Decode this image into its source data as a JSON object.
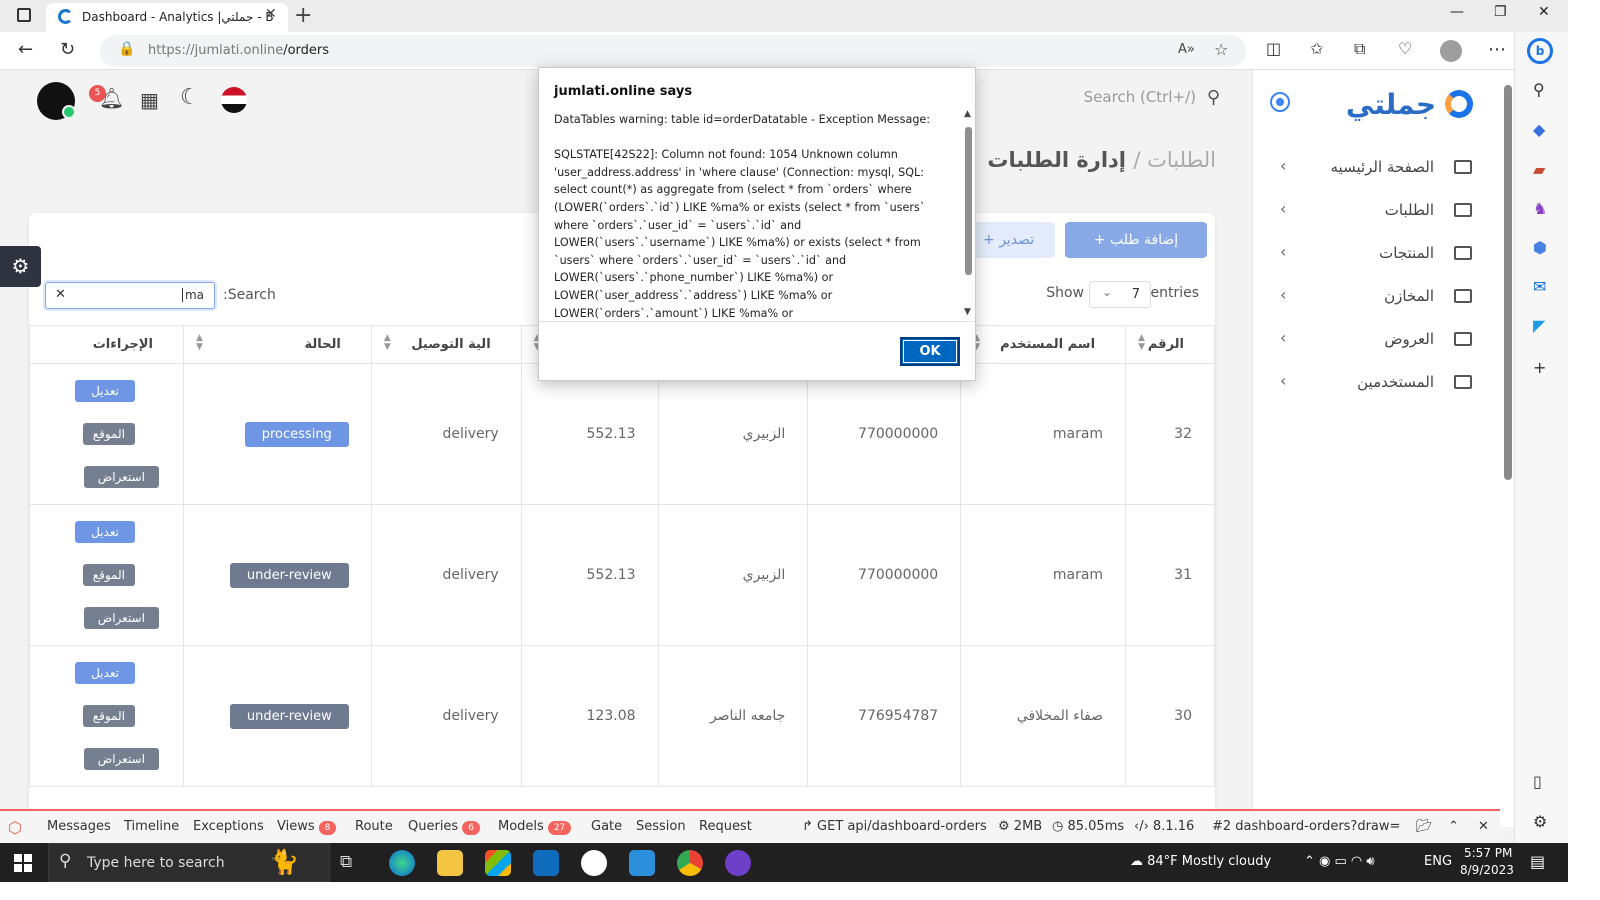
{
  "browser": {
    "tab_title": "Dashboard - Analytics |جملتي - B",
    "url_domain": "https://jumlati.online",
    "url_path": "/orders"
  },
  "sidebar": {
    "logo": "جملتي",
    "items": [
      {
        "label": "الصفحة الرئيسيه"
      },
      {
        "label": "الطلبات"
      },
      {
        "label": "المنتجات"
      },
      {
        "label": "المخازن"
      },
      {
        "label": "العروض"
      },
      {
        "label": "المستخدمين"
      }
    ]
  },
  "header": {
    "search_placeholder": "Search (Ctrl+/)",
    "notif_count": "5"
  },
  "page": {
    "breadcrumb": "الطلبات /",
    "title": "إدارة الطلبات"
  },
  "toolbar": {
    "add_label": "+ إضافة طلب",
    "export_label": "+ تصدير",
    "show_label": "Show",
    "entries_value": "7",
    "entries_label": "entries",
    "search_label": ":Search",
    "search_value": "ma"
  },
  "table": {
    "headers": [
      "الرقم",
      "اسم المستخدم",
      "",
      "",
      "",
      "الية التوصيل",
      "الحالة",
      "الإجراءات"
    ],
    "rows": [
      {
        "id": "32",
        "user": "maram",
        "phone": "770000000",
        "address": "الزبيري",
        "amount": "552.13",
        "delivery": "delivery",
        "status": "processing"
      },
      {
        "id": "31",
        "user": "maram",
        "phone": "770000000",
        "address": "الزبيري",
        "amount": "552.13",
        "delivery": "delivery",
        "status": "under-review"
      },
      {
        "id": "30",
        "user": "صفاء المخلافي",
        "phone": "776954787",
        "address": "جامعه الناصر",
        "amount": "123.08",
        "delivery": "delivery",
        "status": "under-review"
      }
    ],
    "actions": {
      "edit": "تعديل",
      "location": "الموقع",
      "view": "استعراض"
    }
  },
  "dialog": {
    "title": "jumlati.online says",
    "message": "DataTables warning: table id=orderDatatable - Exception Message:\n\nSQLSTATE[42S22]: Column not found: 1054 Unknown column 'user_address.address' in 'where clause' (Connection: mysql, SQL: select count(*) as aggregate from (select * from `orders` where (LOWER(`orders`.`id`) LIKE %ma% or exists (select * from `users` where `orders`.`user_id` = `users`.`id` and LOWER(`users`.`username`) LIKE %ma%) or exists (select * from `users` where `orders`.`user_id` = `users`.`id` and LOWER(`users`.`phone_number`) LIKE %ma%) or LOWER(`user_address`.`address`) LIKE %ma% or LOWER(`orders`.`amount`) LIKE %ma% or LOWER(`orders`.`delivery_type`) LIKE %ma% or LOWER(`orders`.`id`)",
    "ok_label": "OK"
  },
  "debugbar": {
    "items": [
      {
        "label": "Messages"
      },
      {
        "label": "Timeline"
      },
      {
        "label": "Exceptions"
      },
      {
        "label": "Views",
        "count": "8"
      },
      {
        "label": "Route"
      },
      {
        "label": "Queries",
        "count": "6"
      },
      {
        "label": "Models",
        "count": "27"
      },
      {
        "label": "Gate"
      },
      {
        "label": "Session"
      },
      {
        "label": "Request"
      }
    ],
    "request": "GET api/dashboard-orders",
    "memory": "2MB",
    "time": "85.05ms",
    "php": "8.1.16",
    "history": "#2 dashboard-orders?draw="
  },
  "taskbar": {
    "search_placeholder": "Type here to search",
    "weather": "84°F  Mostly cloudy",
    "lang": "ENG",
    "time": "5:57 PM",
    "date": "8/9/2023"
  },
  "colors": {
    "accent": "#6f96e4",
    "debug_red": "#f4645f",
    "ok_blue": "#0067c0"
  }
}
